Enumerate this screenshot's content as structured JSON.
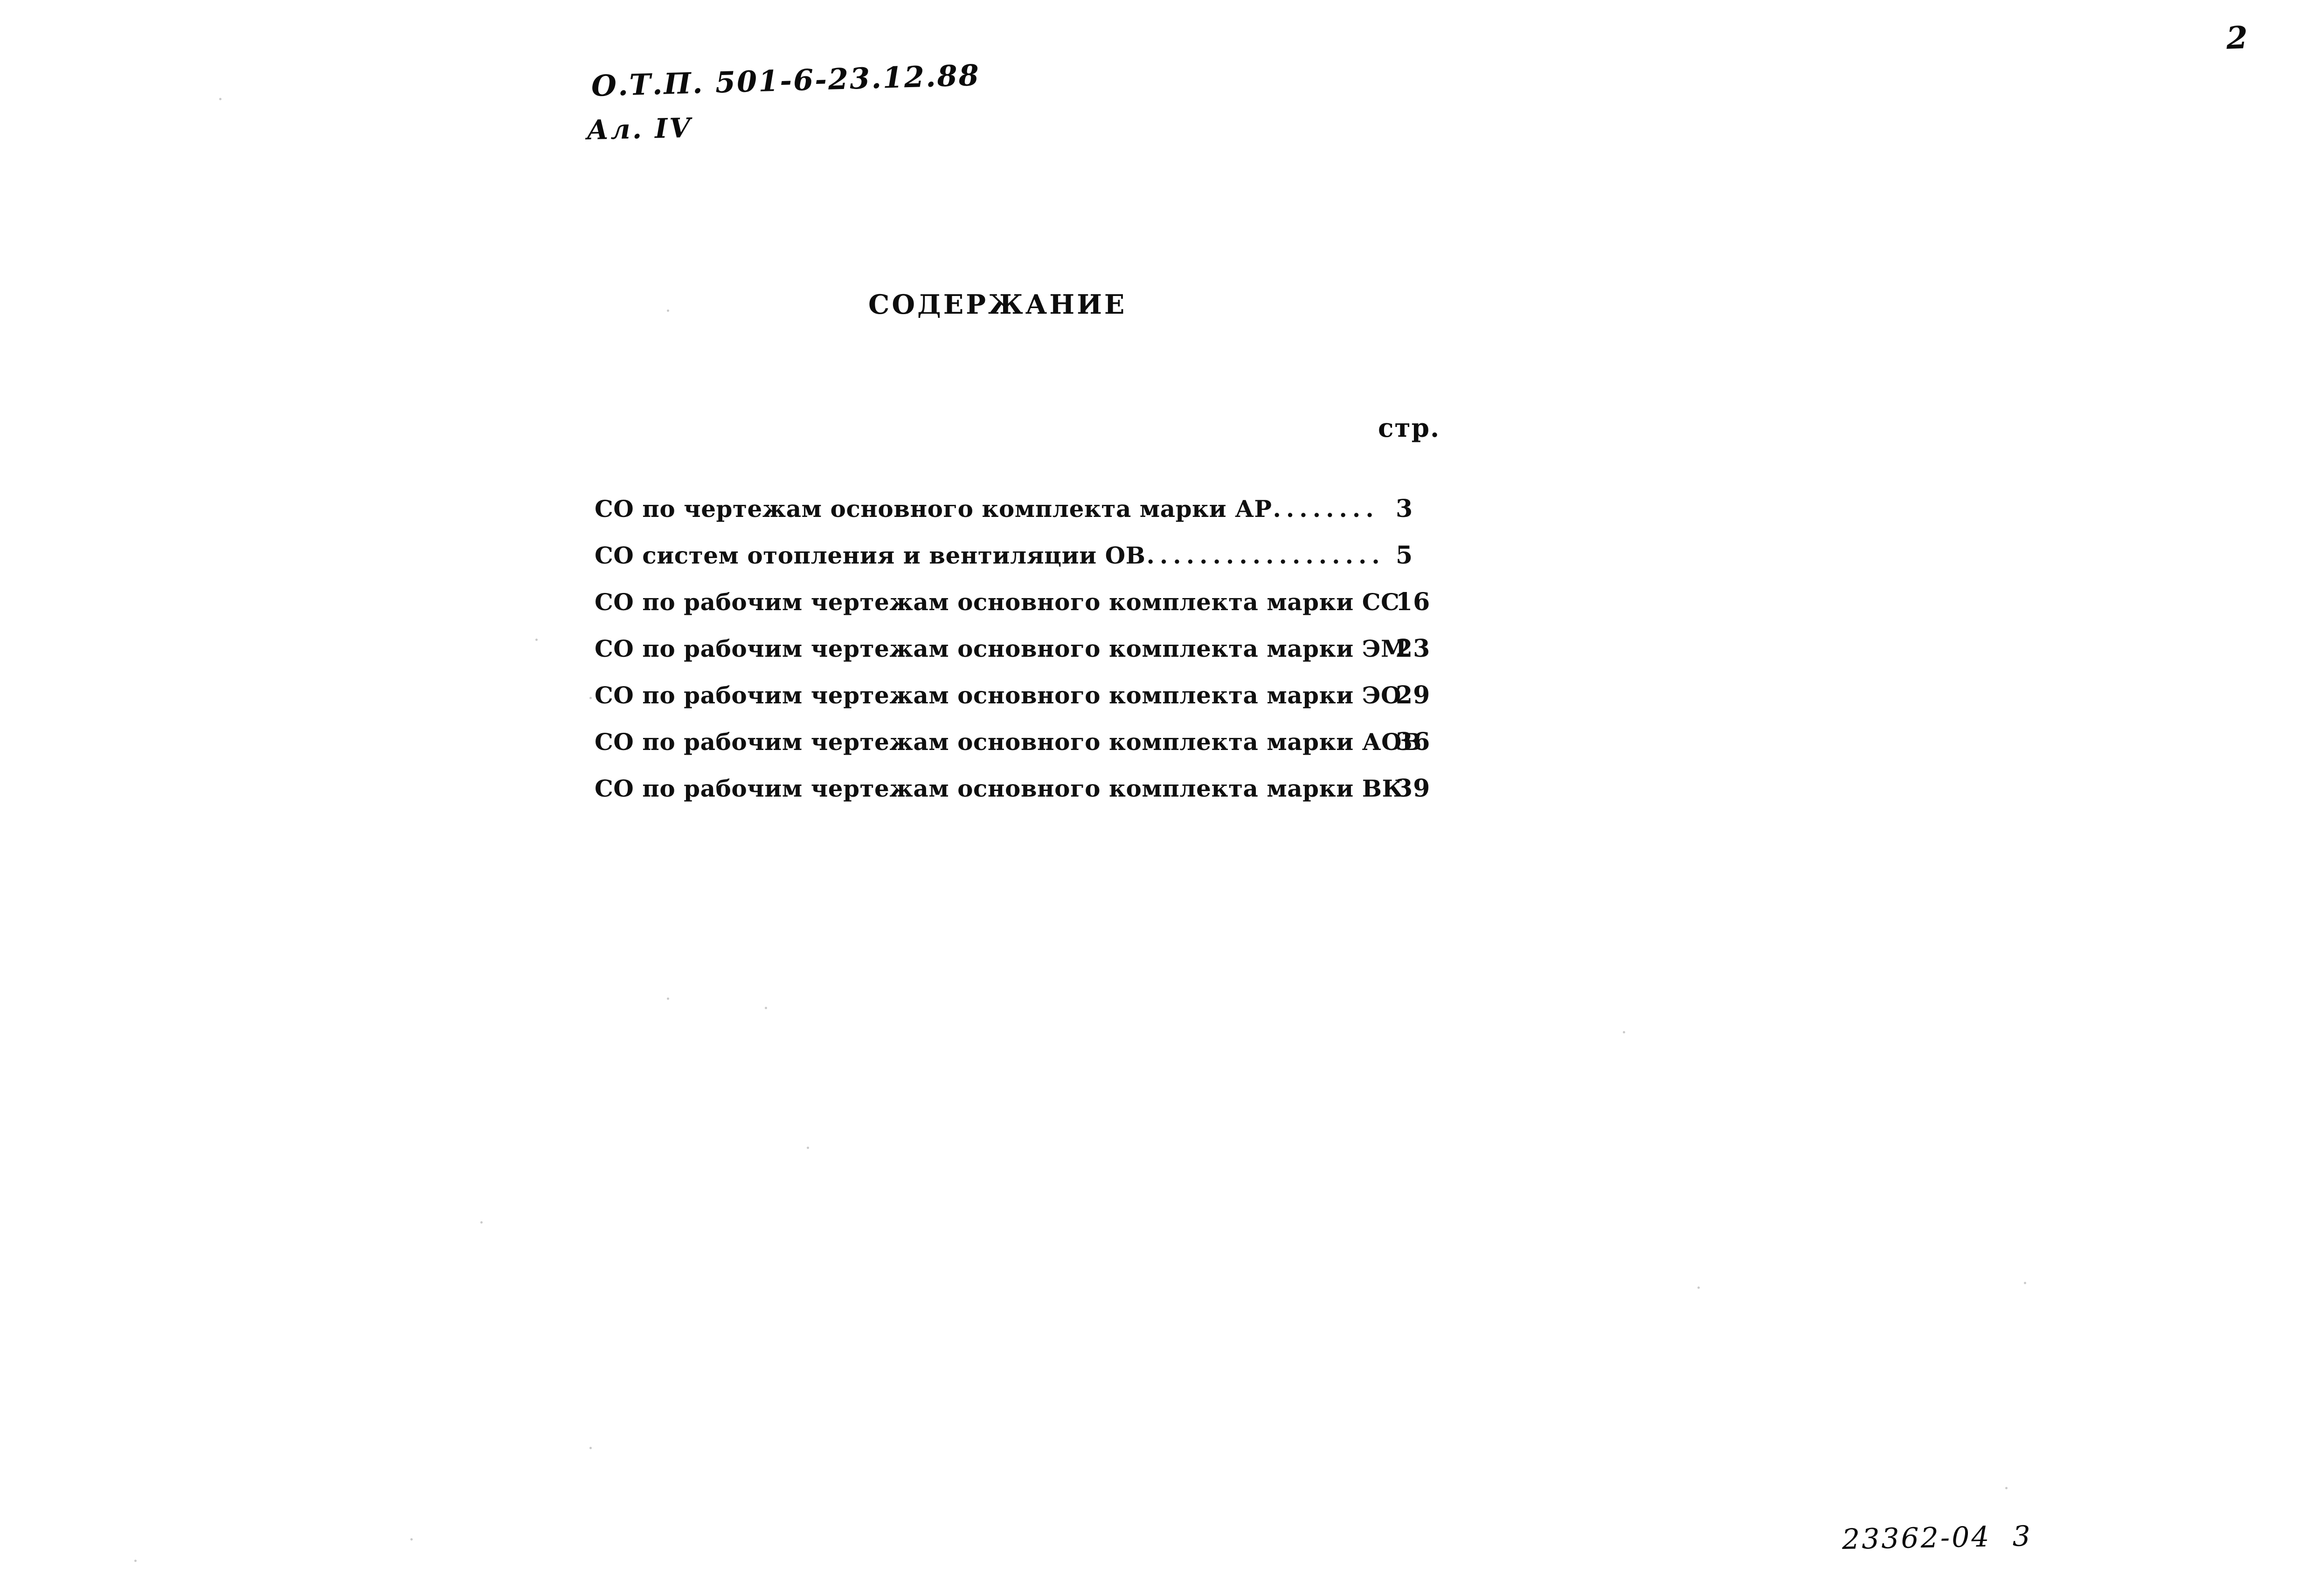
{
  "document": {
    "page_number_top_right": "2",
    "handwritten_code": "О.Т.П. 501-6-23.12.88",
    "handwritten_album": "Ал. IV",
    "archive_stamp": "23362-04  3"
  },
  "contents": {
    "title": "СОДЕРЖАНИЕ",
    "page_column_header": "стр.",
    "entries": [
      {
        "label": "СО по чертежам основного комплекта марки АР",
        "dots": "........",
        "page": "3"
      },
      {
        "label": "СО систем отопления и вентиляции ОВ",
        "dots": "..................",
        "page": "5"
      },
      {
        "label": "СО по рабочим чертежам основного комплекта марки СС",
        "dots": "",
        "page": "16"
      },
      {
        "label": "СО по рабочим чертежам основного комплекта марки ЭМ",
        "dots": "",
        "page": "23"
      },
      {
        "label": "СО по рабочим чертежам основного комплекта марки ЭО",
        "dots": "",
        "page": "29"
      },
      {
        "label": "СО по рабочим чертежам основного комплекта марки АОВ",
        "dots": "",
        "page": "36"
      },
      {
        "label": "СО по рабочим чертежам основного комплекта марки ВК",
        "dots": "",
        "page": "39"
      }
    ]
  }
}
